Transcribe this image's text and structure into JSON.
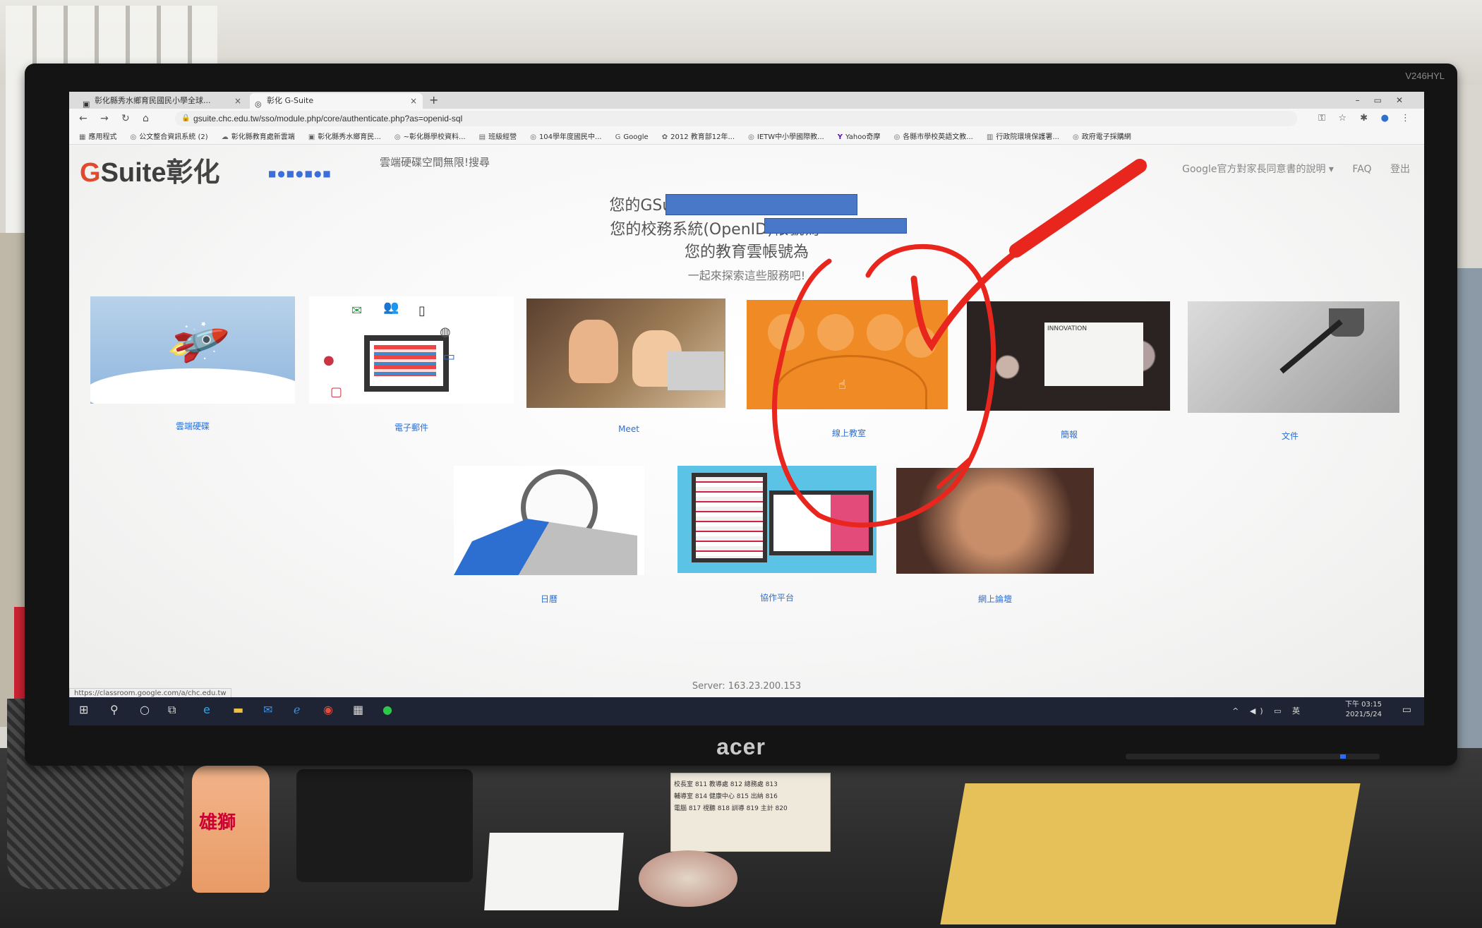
{
  "photo": {
    "monitor_brand": "acer",
    "monitor_model": "V246HYL",
    "bottle_label": "雄獅",
    "note_lines": [
      "校長室 811 教導處 812 總務處 813",
      "輔導室 814 健康中心 815 出納 816",
      "電腦 817 視聽 818 訓導 819 主計 820"
    ]
  },
  "browser": {
    "tabs": [
      {
        "label": "彰化縣秀水鄉育民國民小學全球..."
      },
      {
        "label": "彰化 G-Suite"
      }
    ],
    "new_tab": "+",
    "url": "gsuite.chc.edu.tw/sso/module.php/core/authenticate.php?as=openid-sql",
    "bookmarks": [
      "應用程式",
      "公文整合資訊系統 (2)",
      "彰化縣教育處新雲端",
      "彰化縣秀水鄉育民...",
      "~彰化縣學校資料...",
      "班級經營",
      "104學年度國民中...",
      "Google",
      "2012 教育部12年...",
      "IETW中小學國際教...",
      "Yahoo奇摩",
      "各縣市學校英語文教...",
      "行政院環境保護署...",
      "政府電子採購網"
    ]
  },
  "page": {
    "logo_g": "G",
    "logo_suite": "Suite",
    "logo_zh": "彰化",
    "marquee": "雲端硬碟空間無限!搜尋",
    "top_link_1": "Google官方對家長同意書的說明 ▾",
    "top_link_2": "FAQ",
    "top_link_3": "登出",
    "line1": "您的GSuite為",
    "line2": "您的校務系統(OpenID)帳號為",
    "line3": "您的教育雲帳號為",
    "line4": "一起來探索這些服務吧!",
    "tiles": [
      {
        "label": "雲端硬碟"
      },
      {
        "label": "電子郵件"
      },
      {
        "label": "Meet"
      },
      {
        "label": "線上教室"
      },
      {
        "label": "簡報"
      },
      {
        "label": "文件"
      },
      {
        "label": "日曆"
      },
      {
        "label": "協作平台"
      },
      {
        "label": "網上論壇"
      }
    ],
    "innovation_text": "INNOVATION",
    "server": "Server: 163.23.200.153",
    "status_url": "https://classroom.google.com/a/chc.edu.tw"
  },
  "taskbar": {
    "time": "下午 03:15",
    "date": "2021/5/24",
    "ime": "英"
  },
  "colors": {
    "accent_link": "#2f6fd0",
    "redact": "#4a78c8",
    "annotation_red": "#e8261e",
    "classroom_orange": "#f08a24"
  }
}
